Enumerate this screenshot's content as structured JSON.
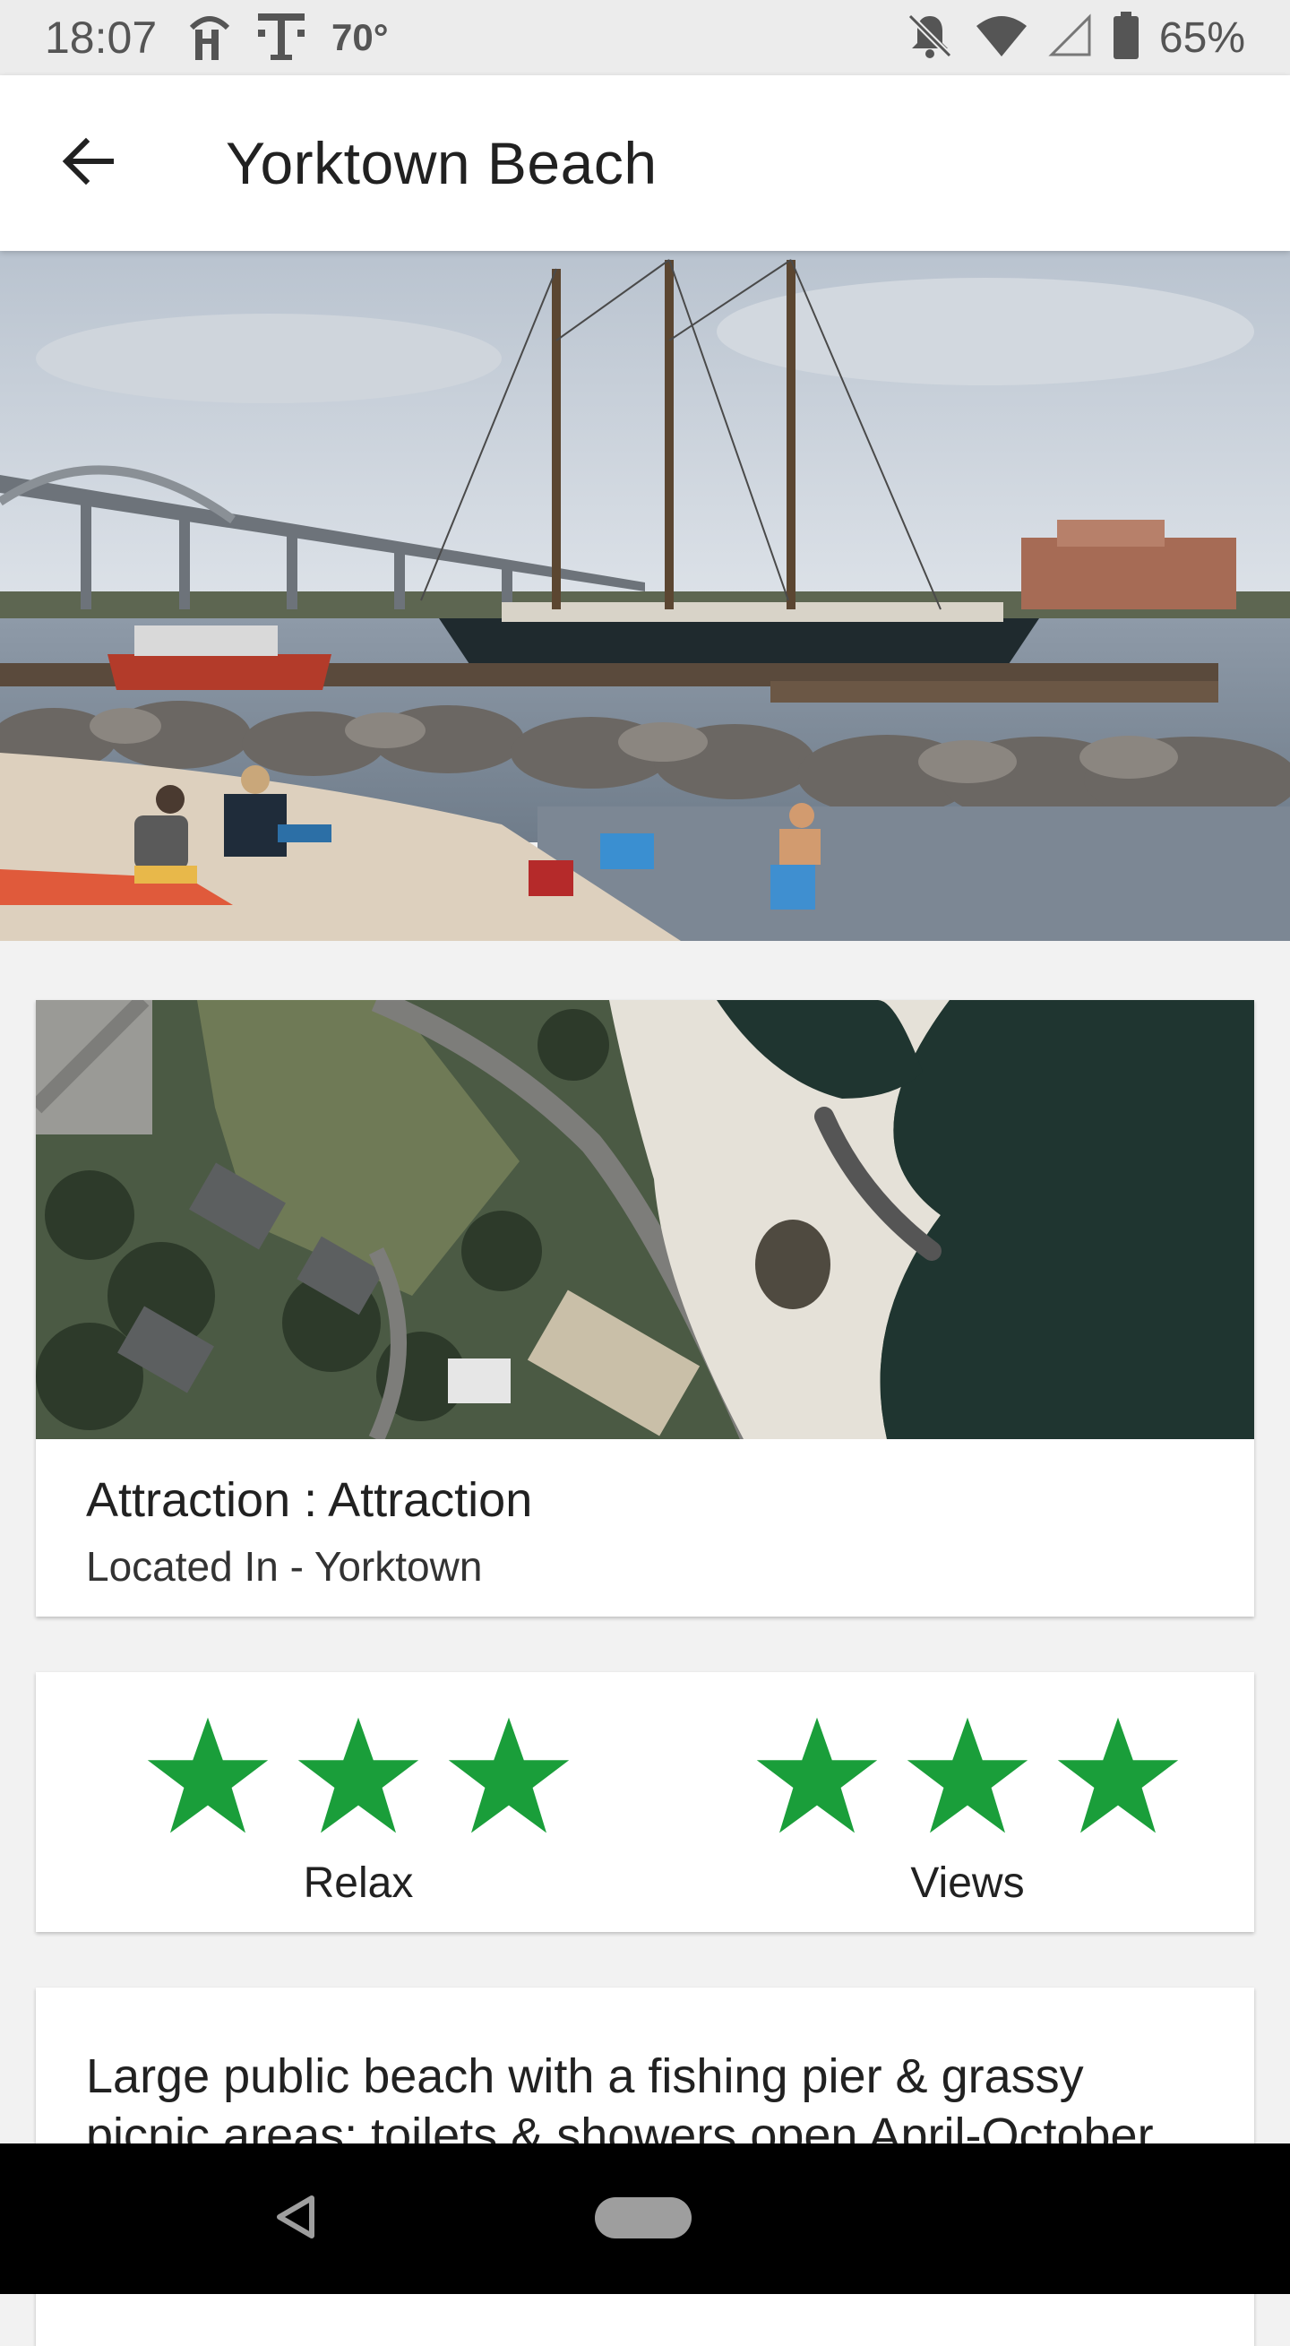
{
  "status_bar": {
    "time": "18:07",
    "temperature": "70°",
    "battery_percent": "65%",
    "icons": [
      "fork-knife-icon",
      "tmobile-icon",
      "notifications-off-icon",
      "wifi-icon",
      "cell-signal-icon",
      "battery-icon"
    ]
  },
  "app_bar": {
    "title": "Yorktown Beach",
    "back_icon": "arrow-back-icon"
  },
  "hero": {
    "image": "beach-harbor-photo"
  },
  "attraction_card": {
    "map_image": "satellite-map",
    "type_line": "Attraction : Attraction",
    "located_line": "Located In - Yorktown"
  },
  "ratings": [
    {
      "label": "Relax",
      "stars": 3,
      "max": 3
    },
    {
      "label": "Views",
      "stars": 3,
      "max": 3
    }
  ],
  "description": {
    "text": "Large public beach with a fishing pier & grassy picnic areas; toilets & showers open April-October"
  },
  "colors": {
    "star": "#1a9e3a",
    "status_bar_bg": "#ececec",
    "app_bar_bg": "#ffffff",
    "page_bg": "#f2f2f2",
    "nav_bar_bg": "#000000"
  },
  "nav_bar": {
    "icons": [
      "nav-back-icon",
      "nav-home-pill"
    ]
  }
}
